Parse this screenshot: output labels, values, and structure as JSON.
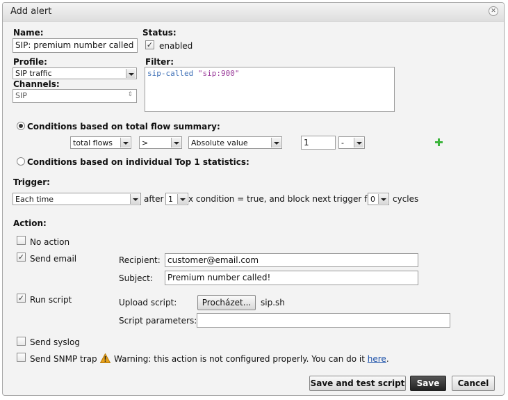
{
  "dialog": {
    "title": "Add alert"
  },
  "name": {
    "label": "Name:",
    "value": "SIP: premium number called"
  },
  "status": {
    "label": "Status:",
    "checkbox_label": "enabled",
    "checked": true
  },
  "profile": {
    "label": "Profile:",
    "value": "SIP traffic"
  },
  "filter": {
    "label": "Filter:",
    "text_keyword": "sip-called ",
    "text_string": "\"sip:900\""
  },
  "channels": {
    "label": "Channels:",
    "value": "SIP"
  },
  "conditions": {
    "summary_label": "Conditions based on total flow summary:",
    "summary_selected": true,
    "metric": "total flows",
    "operator": ">",
    "mode": "Absolute value",
    "threshold": "1",
    "unit": "-",
    "top1_label": "Conditions based on individual Top 1 statistics:"
  },
  "trigger": {
    "label": "Trigger:",
    "mode": "Each time",
    "after_text": "after",
    "count": "1",
    "condition_text": "x condition = true, and block next trigger for",
    "block": "0",
    "cycles_text": "cycles"
  },
  "action": {
    "label": "Action:",
    "no_action": "No action",
    "send_email": "Send email",
    "recipient_label": "Recipient:",
    "recipient_value": "customer@email.com",
    "subject_label": "Subject:",
    "subject_value": "Premium number called!",
    "run_script": "Run script",
    "upload_label": "Upload script:",
    "browse_label": "Procházet...",
    "file_name": "sip.sh",
    "params_label": "Script parameters:",
    "params_value": "",
    "send_syslog": "Send syslog",
    "send_snmp": "Send SNMP trap",
    "warning_text": "Warning: this action is not configured properly. You can do it",
    "warning_link": "here",
    "warning_end": "."
  },
  "buttons": {
    "save_test": "Save and test script",
    "save": "Save",
    "cancel": "Cancel"
  },
  "colors": {
    "keyword": "#3d6fb6",
    "string": "#9a3a9a",
    "add_icon": "#3cb43c",
    "warning": "#e8a21a"
  }
}
